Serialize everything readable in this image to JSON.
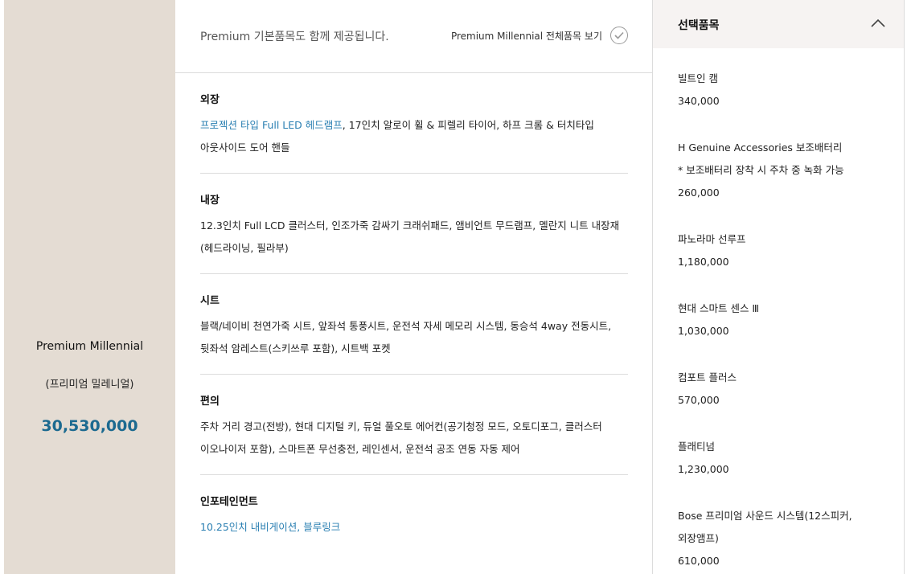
{
  "trim": {
    "name": "Premium Millennial",
    "name_kr": "(프리미엄 밀레니얼)",
    "price": "30,530,000"
  },
  "header": {
    "note": "Premium 기본품목도 함께 제공됩니다.",
    "view_all_label": "Premium Millennial 전체품목 보기",
    "check_icon": "check-circle-icon"
  },
  "sections": [
    {
      "title": "외장",
      "highlight": "프로젝션 타입 Full LED 헤드램프",
      "line1_rest": ", 17인치 알로이 휠 & 피렐리 타이어, 하프 크롬 & 터치타입",
      "line2": "아웃사이드 도어 핸들"
    },
    {
      "title": "내장",
      "line1": "12.3인치 Full LCD 클러스터, 인조가죽 감싸기 크래쉬패드, 앰비언트 무드램프, 멜란지 니트 내장재",
      "line2": "(헤드라이닝, 필라부)"
    },
    {
      "title": "시트",
      "line1": "블랙/네이비 천연가죽 시트, 앞좌석 통풍시트, 운전석 자세 메모리 시스템, 동승석 4way 전동시트,",
      "line2": "뒷좌석 암레스트(스키쓰루 포함), 시트백 포켓"
    },
    {
      "title": "편의",
      "line1": "주차 거리 경고(전방), 현대 디지털 키, 듀얼 풀오토 에어컨(공기청정 모드, 오토디포그, 클러스터",
      "line2": "이오나이저 포함), 스마트폰 무선충전, 레인센서, 운전석 공조 연동 자동 제어"
    },
    {
      "title": "인포테인먼트",
      "highlight": "10.25인치 내비게이션, 블루링크"
    }
  ],
  "selected": {
    "title": "선택품목",
    "collapse_icon": "chevron-up-icon",
    "items": [
      {
        "name": "빌트인 캠",
        "price": "340,000"
      },
      {
        "name": "H Genuine Accessories 보조배터리",
        "note": "* 보조배터리 장착 시 주차 중 녹화 가능",
        "price": "260,000"
      },
      {
        "name": "파노라마 선루프",
        "price": "1,180,000"
      },
      {
        "name": "현대 스마트 센스 Ⅲ",
        "price": "1,030,000"
      },
      {
        "name": "컴포트 플러스",
        "price": "570,000"
      },
      {
        "name": "플래티넘",
        "price": "1,230,000"
      },
      {
        "name": "Bose 프리미엄 사운드 시스템(12스피커,",
        "name_line2": "외장앰프)",
        "price": "610,000"
      }
    ]
  },
  "colors": {
    "accent_blue": "#1c6a90",
    "link_blue": "#2a7fb2",
    "left_panel_bg": "#e4dcd3",
    "right_header_bg": "#f6f3f2"
  }
}
